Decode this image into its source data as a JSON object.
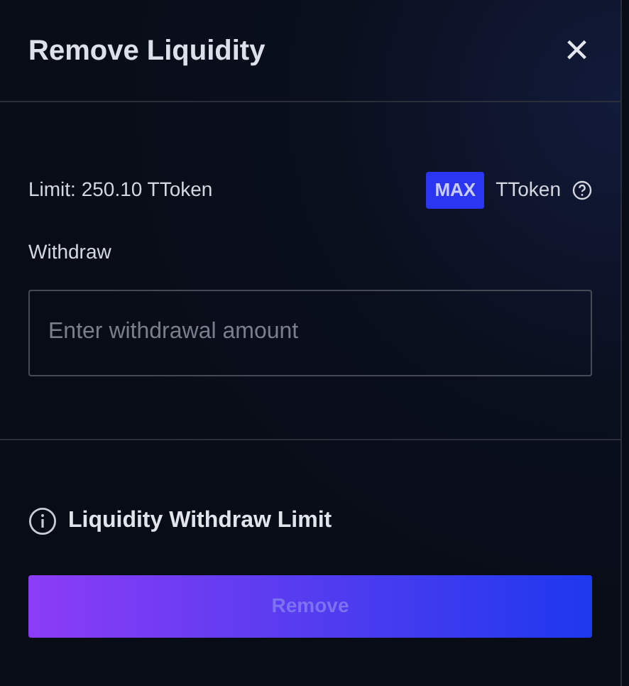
{
  "dialog": {
    "title": "Remove Liquidity",
    "close": "×"
  },
  "limit": {
    "label": "Limit: 250.10 TToken",
    "max_button": "MAX",
    "token": "TToken"
  },
  "withdraw": {
    "label": "Withdraw",
    "placeholder": "Enter withdrawal amount"
  },
  "info": {
    "label": "Liquidity Withdraw Limit"
  },
  "remove_button": {
    "label": "Remove",
    "disabled": true
  }
}
